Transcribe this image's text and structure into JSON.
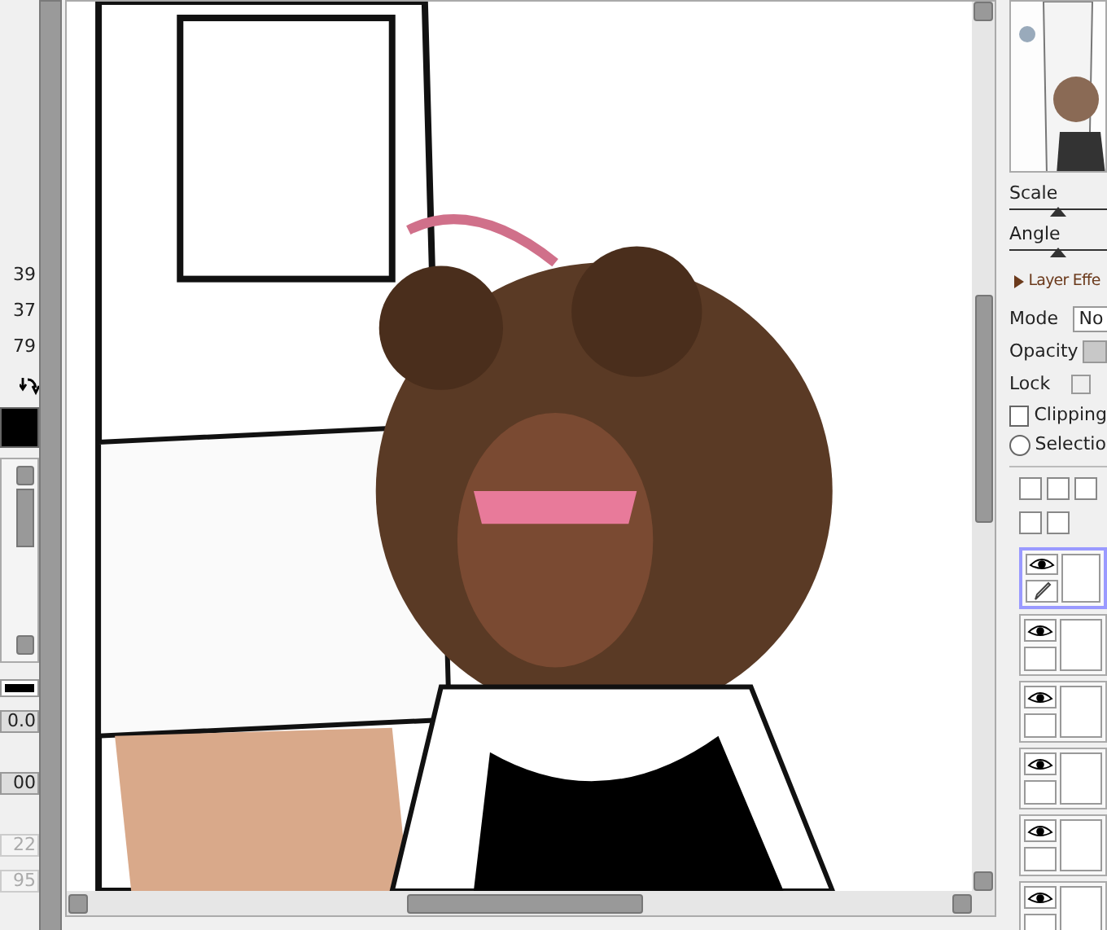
{
  "left_panel": {
    "readouts": [
      "39",
      "37",
      "79"
    ],
    "fields": [
      {
        "value": "0.0",
        "disabled": false
      },
      {
        "value": "00",
        "disabled": false
      },
      {
        "value": "22",
        "disabled": true
      },
      {
        "value": "95",
        "disabled": true
      }
    ]
  },
  "navigator": {
    "sliders": [
      {
        "label": "Scale",
        "level": 0.5
      },
      {
        "label": "Angle",
        "level": 0.5
      }
    ]
  },
  "layer_effects": {
    "title": "Layer Effe",
    "expanded": false
  },
  "layer_props": {
    "mode_label": "Mode",
    "mode_value": "No",
    "opacity_label": "Opacity",
    "lock_label": "Lock",
    "clipping": {
      "label": "Clipping",
      "checked": false
    },
    "selection": {
      "label": "Selectio",
      "selected": false
    }
  },
  "layers": [
    {
      "selected": true,
      "visible": true,
      "editing": true
    },
    {
      "selected": false,
      "visible": true,
      "editing": false
    },
    {
      "selected": false,
      "visible": true,
      "editing": false
    },
    {
      "selected": false,
      "visible": true,
      "editing": false
    },
    {
      "selected": false,
      "visible": true,
      "editing": false
    },
    {
      "selected": false,
      "visible": true,
      "editing": false
    }
  ]
}
